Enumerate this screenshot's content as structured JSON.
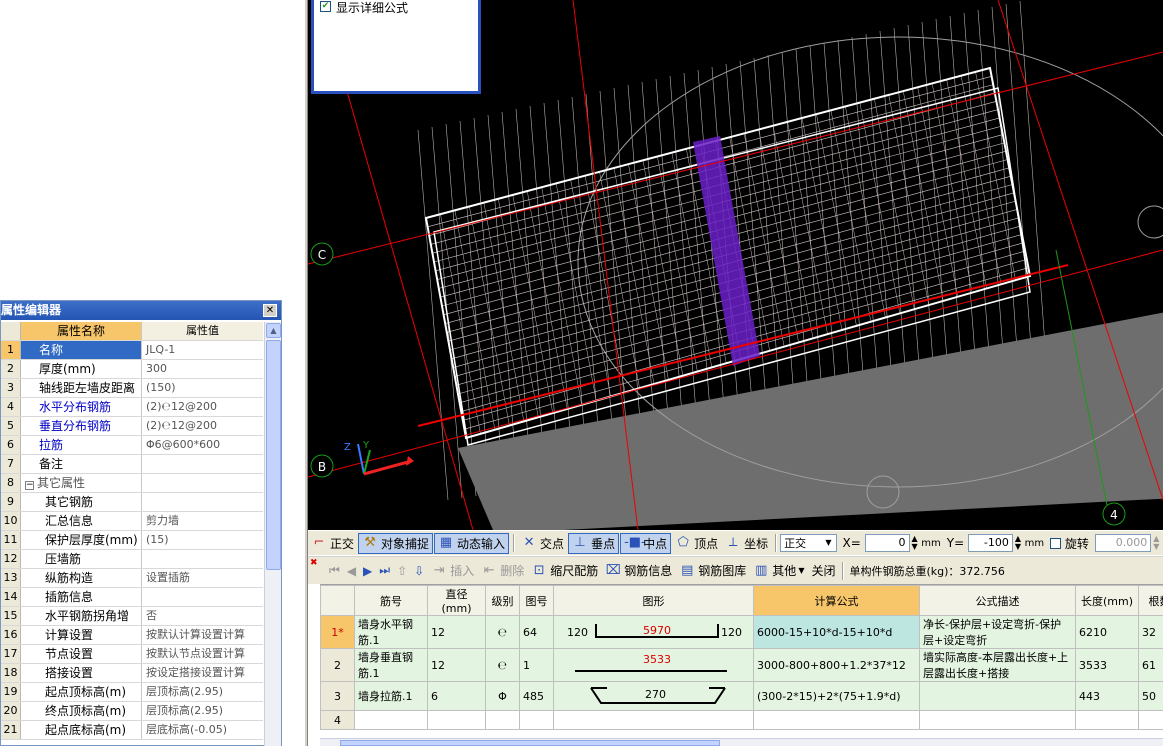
{
  "popup": {
    "checkbox_label": "显示详细公式",
    "checked": true
  },
  "viewport": {
    "axis_labels": {
      "c": "C",
      "b": "B",
      "four": "4"
    },
    "ucs": {
      "z": "Z",
      "y": "Y"
    }
  },
  "prop_editor": {
    "title": "属性编辑器",
    "headers": {
      "name": "属性名称",
      "value": "属性值"
    },
    "rows": [
      {
        "num": "1",
        "name": "名称",
        "value": "JLQ-1"
      },
      {
        "num": "2",
        "name": "厚度(mm)",
        "value": "300"
      },
      {
        "num": "3",
        "name": "轴线距左墙皮距离",
        "value": "(150)"
      },
      {
        "num": "4",
        "name": "水平分布钢筋",
        "value": "(2)℮12@200"
      },
      {
        "num": "5",
        "name": "垂直分布钢筋",
        "value": "(2)℮12@200"
      },
      {
        "num": "6",
        "name": "拉筋",
        "value": "Φ6@600*600"
      },
      {
        "num": "7",
        "name": "备注",
        "value": ""
      },
      {
        "num": "8",
        "name": "其它属性",
        "value": ""
      },
      {
        "num": "9",
        "name": "其它钢筋",
        "value": ""
      },
      {
        "num": "10",
        "name": "汇总信息",
        "value": "剪力墙"
      },
      {
        "num": "11",
        "name": "保护层厚度(mm)",
        "value": "(15)"
      },
      {
        "num": "12",
        "name": "压墙筋",
        "value": ""
      },
      {
        "num": "13",
        "name": "纵筋构造",
        "value": "设置插筋"
      },
      {
        "num": "14",
        "name": "插筋信息",
        "value": ""
      },
      {
        "num": "15",
        "name": "水平钢筋拐角增",
        "value": "否"
      },
      {
        "num": "16",
        "name": "计算设置",
        "value": "按默认计算设置计算"
      },
      {
        "num": "17",
        "name": "节点设置",
        "value": "按默认节点设置计算"
      },
      {
        "num": "18",
        "name": "搭接设置",
        "value": "按设定搭接设置计算"
      },
      {
        "num": "19",
        "name": "起点顶标高(m)",
        "value": "层顶标高(2.95)"
      },
      {
        "num": "20",
        "name": "终点顶标高(m)",
        "value": "层顶标高(2.95)"
      },
      {
        "num": "21",
        "name": "起点底标高(m)",
        "value": "层底标高(-0.05)"
      }
    ],
    "collapse_symbol": "−"
  },
  "toolbar1": {
    "ortho": "正交",
    "snap": "对象捕捉",
    "dynamic_input": "动态输入",
    "intersection": "交点",
    "perpendicular": "垂点",
    "midpoint": "中点",
    "vertex": "顶点",
    "coordinate": "坐标",
    "mode_value": "正交",
    "x_label": "X=",
    "x_value": "0",
    "y_label": "Y=",
    "y_value": "-100",
    "unit": "mm",
    "rotate_label": "旋转",
    "rotate_value": "0.000"
  },
  "toolbar2": {
    "insert": "插入",
    "delete": "删除",
    "scale_rebar": "缩尺配筋",
    "rebar_info": "钢筋信息",
    "rebar_library": "钢筋图库",
    "other": "其他",
    "close": "关闭",
    "total_weight": "单构件钢筋总重(kg)：372.756"
  },
  "grid": {
    "headers": [
      "筋号",
      "直径(mm)",
      "级别",
      "图号",
      "图形",
      "计算公式",
      "公式描述",
      "长度(mm)",
      "根数"
    ],
    "rows": [
      {
        "rn": "1*",
        "name": "墙身水平钢筋.1",
        "dia": "12",
        "grade": "℮",
        "fig": "64",
        "shape_left": "120",
        "shape_mid": "5970",
        "shape_right": "120",
        "formula": "6000-15+10*d-15+10*d",
        "desc": "净长-保护层+设定弯折-保护层+设定弯折",
        "len": "6210",
        "count": "32"
      },
      {
        "rn": "2",
        "name": "墙身垂直钢筋.1",
        "dia": "12",
        "grade": "℮",
        "fig": "1",
        "shape_mid": "3533",
        "formula": "3000-800+800+1.2*37*12",
        "desc": "墙实际高度-本层露出长度+上层露出长度+搭接",
        "len": "3533",
        "count": "61"
      },
      {
        "rn": "3",
        "name": "墙身拉筋.1",
        "dia": "6",
        "grade": "Φ",
        "fig": "485",
        "shape_mid": "270",
        "formula": "(300-2*15)+2*(75+1.9*d)",
        "desc": "",
        "len": "443",
        "count": "50"
      },
      {
        "rn": "4",
        "name": "",
        "dia": "",
        "grade": "",
        "fig": "",
        "formula": "",
        "desc": "",
        "len": "",
        "count": ""
      }
    ]
  }
}
